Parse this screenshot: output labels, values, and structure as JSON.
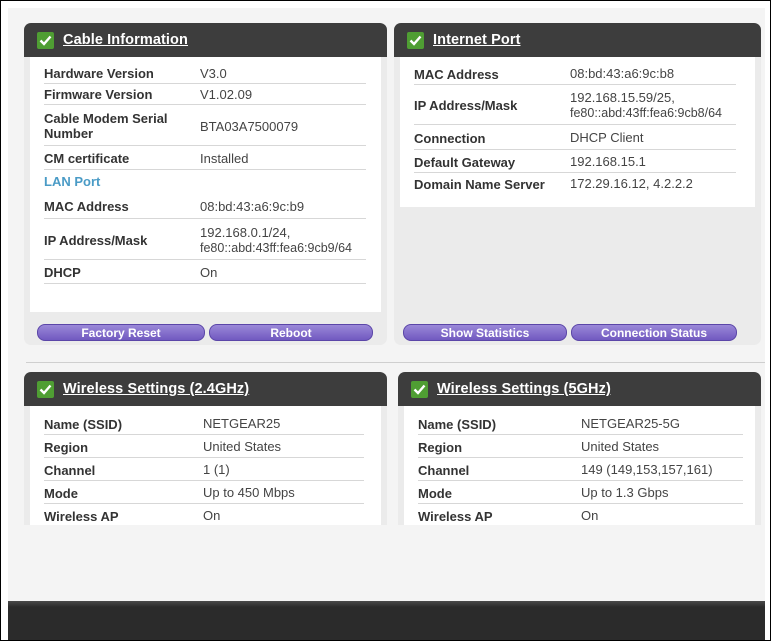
{
  "cable_info": {
    "title": "Cable Information",
    "rows": [
      {
        "label": "Hardware Version",
        "value": "V3.0"
      },
      {
        "label": "Firmware Version",
        "value": "V1.02.09"
      },
      {
        "label": "Cable Modem Serial Number",
        "value": "BTA03A7500079"
      },
      {
        "label": "CM certificate",
        "value": "Installed"
      }
    ],
    "lan_port_label": "LAN Port",
    "lan_rows": [
      {
        "label": "MAC Address",
        "value": "08:bd:43:a6:9c:b9"
      },
      {
        "label": "IP Address/Mask",
        "value_line1": "192.168.0.1/24,",
        "value_line2": "fe80::abd:43ff:fea6:9cb9/64"
      },
      {
        "label": "DHCP",
        "value": "On"
      }
    ],
    "factory_reset_label": "Factory Reset",
    "reboot_label": "Reboot"
  },
  "internet_port": {
    "title": "Internet Port",
    "rows": [
      {
        "label": "MAC Address",
        "value": "08:bd:43:a6:9c:b8"
      },
      {
        "label": "IP Address/Mask",
        "value_line1": "192.168.15.59/25,",
        "value_line2": "fe80::abd:43ff:fea6:9cb8/64"
      },
      {
        "label": "Connection",
        "value": "DHCP Client"
      },
      {
        "label": "Default Gateway",
        "value": "192.168.15.1"
      },
      {
        "label": "Domain Name Server",
        "value": "172.29.16.12, 4.2.2.2"
      }
    ],
    "show_statistics_label": "Show Statistics",
    "connection_status_label": "Connection Status"
  },
  "wireless_24": {
    "title": "Wireless Settings (2.4GHz)",
    "rows": [
      {
        "label": "Name (SSID)",
        "value": "NETGEAR25"
      },
      {
        "label": "Region",
        "value": "United States"
      },
      {
        "label": "Channel",
        "value": "1 (1)"
      },
      {
        "label": "Mode",
        "value": "Up to 450 Mbps"
      },
      {
        "label": "Wireless AP",
        "value": "On"
      }
    ]
  },
  "wireless_5": {
    "title": "Wireless Settings (5GHz)",
    "rows": [
      {
        "label": "Name (SSID)",
        "value": "NETGEAR25-5G"
      },
      {
        "label": "Region",
        "value": "United States"
      },
      {
        "label": "Channel",
        "value": "149 (149,153,157,161)"
      },
      {
        "label": "Mode",
        "value": "Up to 1.3 Gbps"
      },
      {
        "label": "Wireless AP",
        "value": "On"
      }
    ]
  },
  "icons": {
    "panel_status": "checkmark-icon"
  },
  "colors": {
    "header": "#3d3d3d",
    "check": "#4f9e33",
    "button": "#7159c0",
    "section_link": "#4a9bc6"
  }
}
